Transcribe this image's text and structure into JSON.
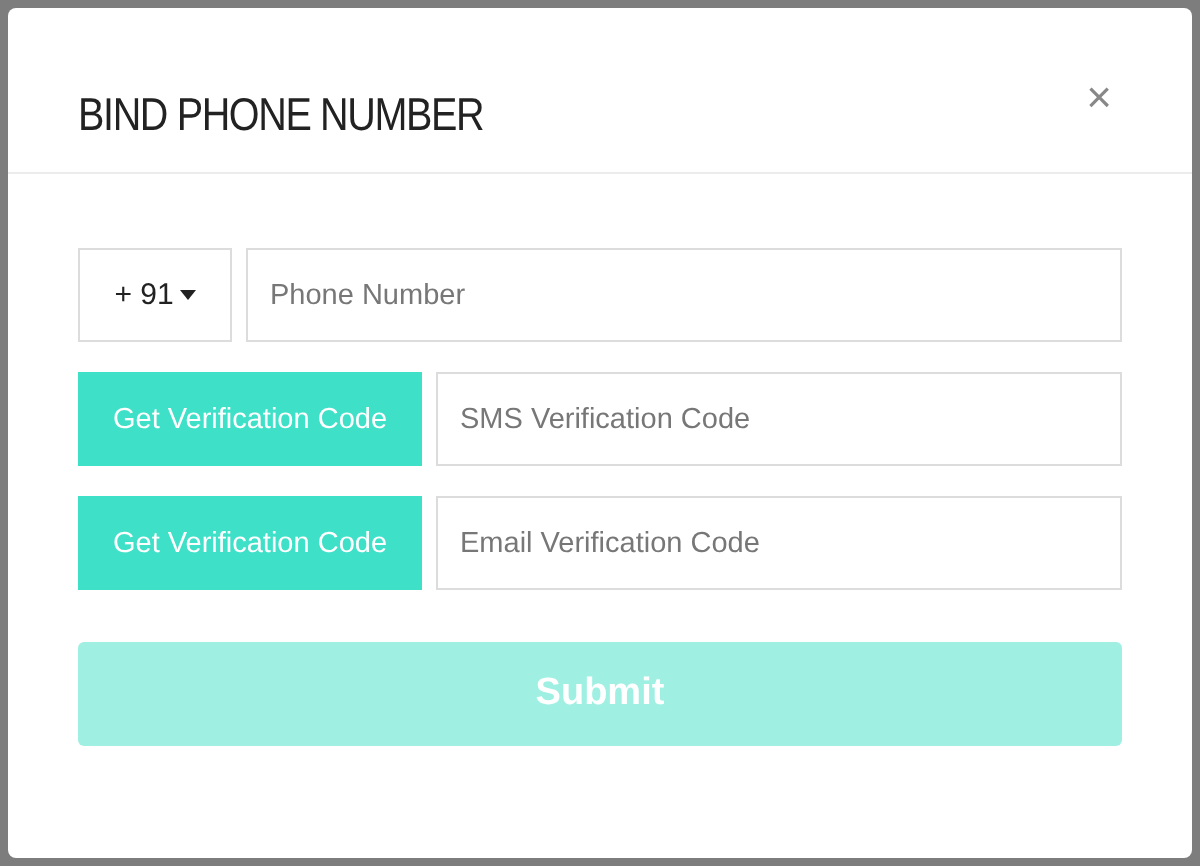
{
  "dialog": {
    "title": "BIND PHONE NUMBER",
    "close": "×"
  },
  "phone": {
    "country_code": "+ 91",
    "placeholder": "Phone Number"
  },
  "verification_rows": [
    {
      "button": "Get Verification Code",
      "placeholder": "SMS Verification Code"
    },
    {
      "button": "Get Verification Code",
      "placeholder": "Email Verification Code"
    }
  ],
  "submit": {
    "label": "Submit",
    "disabled": true
  }
}
